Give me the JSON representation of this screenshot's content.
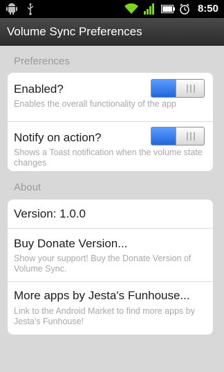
{
  "status_bar": {
    "time": "8:50",
    "icons": [
      "android-icon",
      "usb-icon",
      "wifi-icon",
      "signal-icon",
      "battery-icon",
      "alarm-icon"
    ]
  },
  "title_bar": {
    "title": "Volume Sync Preferences"
  },
  "sections": {
    "preferences": {
      "header": "Preferences",
      "enabled": {
        "title": "Enabled?",
        "summary": "Enables the overall functionality of the app",
        "checked": true
      },
      "notify": {
        "title": "Notify on action?",
        "summary": "Shows a Toast notification when the volume state changes",
        "checked": true
      }
    },
    "about": {
      "header": "About",
      "version": {
        "title": "Version: 1.0.0"
      },
      "donate": {
        "title": "Buy Donate Version...",
        "summary": "Show your support! Buy the Donate Version of Volume Sync."
      },
      "more_apps": {
        "title": "More apps by Jesta's Funhouse...",
        "summary": "Link to the Android Market to find more apps by Jesta's Funhouse!"
      }
    }
  },
  "colors": {
    "toggle_on": "#2f6fd0",
    "background": "#d8d8d8",
    "titlebar": "#3a3a3a"
  }
}
